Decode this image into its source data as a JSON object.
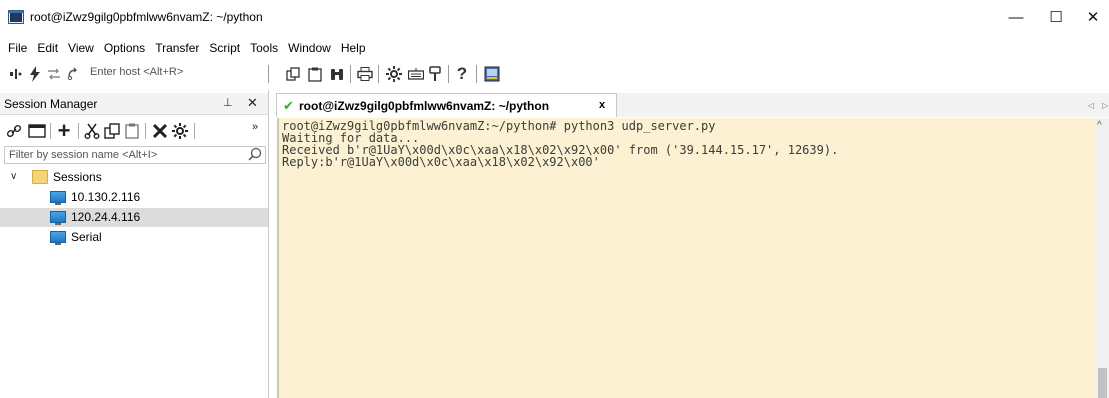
{
  "window": {
    "title": "root@iZwz9gilg0pbfmlww6nvamZ: ~/python",
    "minimize": "—",
    "maximize": "☐",
    "close": "✕"
  },
  "menu": [
    "File",
    "Edit",
    "View",
    "Options",
    "Transfer",
    "Script",
    "Tools",
    "Window",
    "Help"
  ],
  "toolbar": {
    "host_placeholder": "Enter host <Alt+R>"
  },
  "session_manager": {
    "title": "Session Manager",
    "pin": "⊥",
    "close": "✕",
    "filter_placeholder": "Filter by session name <Alt+I>",
    "tree": {
      "root_label": "Sessions",
      "items": [
        "10.130.2.116",
        "120.24.4.116",
        "Serial"
      ],
      "selected_index": 1
    }
  },
  "tab": {
    "label": "root@iZwz9gilg0pbfmlww6nvamZ: ~/python",
    "close": "x"
  },
  "terminal": {
    "lines": [
      "root@iZwz9gilg0pbfmlww6nvamZ:~/python# python3 udp_server.py",
      "Waiting for data...",
      "Received b'r@1UaY\\x00d\\x0c\\xaa\\x18\\x02\\x92\\x00' from ('39.144.15.17', 12639).",
      "Reply:b'r@1UaY\\x00d\\x0c\\xaa\\x18\\x02\\x92\\x00'"
    ]
  },
  "colors": {
    "terminal_bg": "#fcf1d2",
    "connected_check": "#2bb22b",
    "selected_row": "#dcdcdc"
  }
}
